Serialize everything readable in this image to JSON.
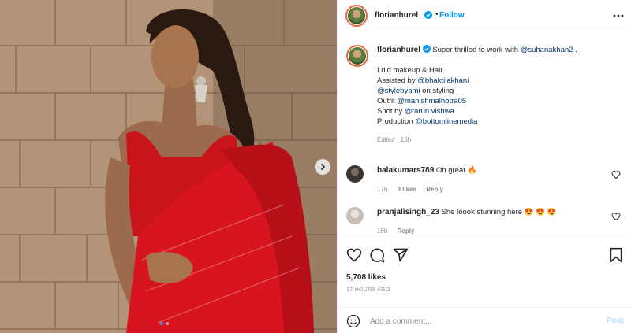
{
  "post": {
    "author": "florianhurel",
    "follow_label": "Follow",
    "follow_separator": "•",
    "caption": {
      "author": "florianhurel",
      "intro": "Super thrilled to work with",
      "intro_mention": "@suhanakhan2",
      "intro_end": ".",
      "line1": "I did makeup & Hair .",
      "line2_prefix": "Assisted by",
      "line2_mention": "@bhaktilakhani",
      "line3_mention": "@stylebyami",
      "line3_suffix": "on styling",
      "line4_prefix": "Outfit",
      "line4_mention": "@manishmalhotra05",
      "line5_prefix": "Shot by",
      "line5_mention": "@tarun.vishwa",
      "line6_prefix": "Production",
      "line6_mention": "@bottomlinemedia",
      "meta": "Edited · 15h"
    },
    "comments": [
      {
        "user": "balakumars789",
        "text": "Oh great",
        "emoji": "🔥",
        "time": "17h",
        "likes": "3 likes",
        "reply": "Reply"
      },
      {
        "user": "pranjalisingh_23",
        "text": "She loook stunning here",
        "emoji": "😍 😍 😍",
        "time": "16h",
        "reply": "Reply"
      }
    ],
    "likes": "5,708 likes",
    "posted": "17 HOURS AGO",
    "add_comment": {
      "placeholder": "Add a comment...",
      "post_label": "Post"
    },
    "carousel": {
      "slides": 2,
      "active": 1
    }
  },
  "colors": {
    "accent": "#0095f6",
    "mention": "#00376b",
    "muted": "#8e8e8e",
    "post_disabled": "#b3dbff",
    "saree_red": "#d8141e"
  },
  "icons": [
    "verified-badge-icon",
    "more-options-icon",
    "next-slide-icon",
    "heart-icon",
    "comment-icon",
    "share-icon",
    "bookmark-icon",
    "emoji-icon"
  ]
}
